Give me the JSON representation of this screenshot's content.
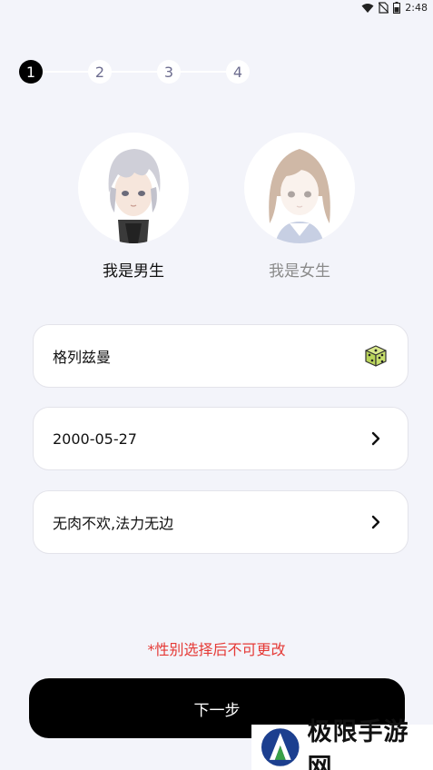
{
  "status_bar": {
    "time": "2:48"
  },
  "stepper": {
    "steps": [
      "1",
      "2",
      "3",
      "4"
    ],
    "active_index": 0
  },
  "gender": {
    "male_label": "我是男生",
    "female_label": "我是女生",
    "selected": "male"
  },
  "form": {
    "nickname": "格列兹曼",
    "birthday": "2000-05-27",
    "signature": "无肉不欢,法力无边"
  },
  "warning": "*性别选择后不可更改",
  "next_button": "下一步",
  "watermark": "极限手游网",
  "colors": {
    "accent": "#000000",
    "warning": "#e53935",
    "background": "#f3f4fa"
  }
}
